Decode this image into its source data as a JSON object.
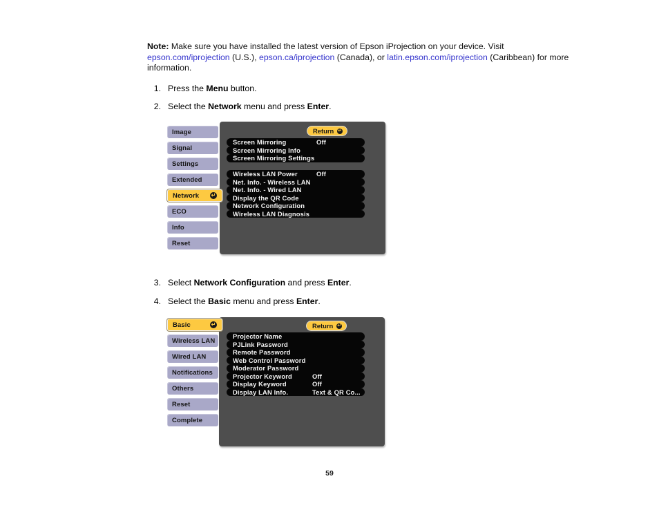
{
  "document": {
    "note": {
      "label": "Note:",
      "text_1": " Make sure you have installed the latest version of Epson iProjection on your device. Visit ",
      "link_1": "epson.com/iprojection",
      "text_2": " (U.S.), ",
      "link_2": "epson.ca/iprojection",
      "text_3": " (Canada), or ",
      "link_3": "latin.epson.com/iprojection",
      "text_4": " (Caribbean) for more information."
    },
    "steps": [
      {
        "num": "1.",
        "pre": "Press the ",
        "bold_1": "Menu",
        "mid": " button.",
        "bold_2": "",
        "post": ""
      },
      {
        "num": "2.",
        "pre": "Select the ",
        "bold_1": "Network",
        "mid": " menu and press ",
        "bold_2": "Enter",
        "post": "."
      },
      {
        "num": "3.",
        "pre": "Select ",
        "bold_1": "Network Configuration",
        "mid": " and press ",
        "bold_2": "Enter",
        "post": "."
      },
      {
        "num": "4.",
        "pre": "Select the ",
        "bold_1": "Basic",
        "mid": " menu and press ",
        "bold_2": "Enter",
        "post": "."
      }
    ],
    "page_number": "59"
  },
  "colors": {
    "panel_gray": "#4e4e4e",
    "tab_inactive": "#a9a8c8",
    "tab_active": "#fdc941",
    "row_black": "#060606",
    "link_blue": "#3333cc"
  },
  "osd_1": {
    "return_label": "Return",
    "enter_symbol": "↵",
    "tabs": [
      {
        "label": "Image",
        "active": false
      },
      {
        "label": "Signal",
        "active": false
      },
      {
        "label": "Settings",
        "active": false
      },
      {
        "label": "Extended",
        "active": false
      },
      {
        "label": "Network",
        "active": true
      },
      {
        "label": "ECO",
        "active": false
      },
      {
        "label": "Info",
        "active": false
      },
      {
        "label": "Reset",
        "active": false
      }
    ],
    "group_1": [
      {
        "label": "Screen Mirroring",
        "value": "Off"
      },
      {
        "label": "Screen Mirroring Info",
        "value": ""
      },
      {
        "label": "Screen Mirroring Settings",
        "value": ""
      }
    ],
    "group_2": [
      {
        "label": "Wireless LAN Power",
        "value": "Off"
      },
      {
        "label": "Net. Info. - Wireless LAN",
        "value": ""
      },
      {
        "label": "Net. Info. - Wired LAN",
        "value": ""
      },
      {
        "label": "Display the QR Code",
        "value": ""
      },
      {
        "label": "Network Configuration",
        "value": ""
      },
      {
        "label": "Wireless LAN Diagnosis",
        "value": ""
      }
    ]
  },
  "osd_2": {
    "return_label": "Return",
    "enter_symbol": "↵",
    "tabs": [
      {
        "label": "Basic",
        "active": true
      },
      {
        "label": "Wireless LAN",
        "active": false
      },
      {
        "label": "Wired LAN",
        "active": false
      },
      {
        "label": "Notifications",
        "active": false
      },
      {
        "label": "Others",
        "active": false
      },
      {
        "label": "Reset",
        "active": false
      },
      {
        "label": "Complete",
        "active": false
      }
    ],
    "group_1": [
      {
        "label": "Projector Name",
        "value": ""
      },
      {
        "label": "PJLink Password",
        "value": ""
      },
      {
        "label": "Remote Password",
        "value": ""
      },
      {
        "label": "Web Control Password",
        "value": ""
      },
      {
        "label": "Moderator Password",
        "value": ""
      },
      {
        "label": "Projector Keyword",
        "value": "Off"
      },
      {
        "label": "Display Keyword",
        "value": "Off"
      },
      {
        "label": "Display LAN Info.",
        "value": "Text & QR Co..."
      }
    ]
  }
}
